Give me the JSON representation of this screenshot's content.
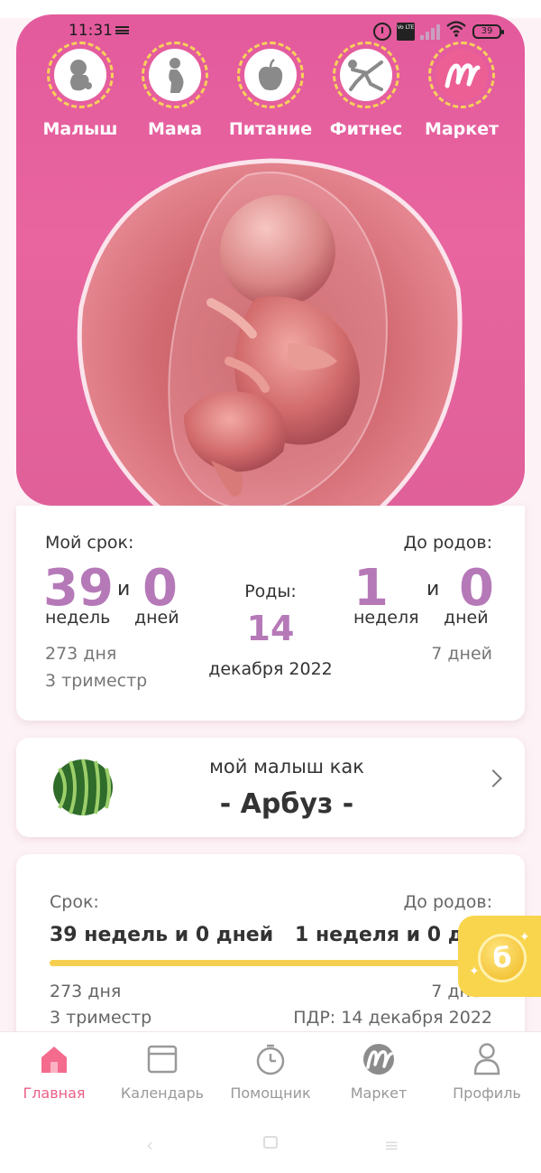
{
  "status_bar": {
    "time": "11:31",
    "volte": "Vo LTE",
    "battery": "39"
  },
  "top_nav": [
    {
      "label": "Малыш",
      "icon": "baby-icon"
    },
    {
      "label": "Мама",
      "icon": "pregnant-mother-icon"
    },
    {
      "label": "Питание",
      "icon": "apple-icon"
    },
    {
      "label": "Фитнес",
      "icon": "fitness-icon"
    },
    {
      "label": "Маркет",
      "icon": "market-logo-icon"
    }
  ],
  "term": {
    "my_term_label": "Мой срок:",
    "weeks_value": "39",
    "and_word": "и",
    "days_value": "0",
    "weeks_unit": "недель",
    "days_unit": "дней",
    "total_days": "273 дня",
    "trimester": "3 триместр",
    "birth_label": "Роды:",
    "birth_day": "14",
    "birth_month_year": "декабря 2022",
    "until_birth_label": "До родов:",
    "remaining_weeks": "1",
    "remaining_and": "и",
    "remaining_days": "0",
    "remaining_weeks_unit": "неделя",
    "remaining_days_unit": "дней",
    "remaining_total_days": "7 дней"
  },
  "baby_like": {
    "title": "мой малыш как",
    "fruit": "- Арбуз -"
  },
  "summary": {
    "term_label": "Срок:",
    "term_value": "39 недель и 0 дней",
    "until_label": "До родов:",
    "until_value": "1 неделя и 0 дней",
    "progress": 0.975,
    "total_days": "273 дня",
    "remaining_days": "7 дней",
    "trimester": "3 триместр",
    "due_date": "ПДР: 14 декабря 2022"
  },
  "bottom_nav": [
    {
      "label": "Главная",
      "icon": "home-icon",
      "active": true
    },
    {
      "label": "Календарь",
      "icon": "calendar-icon",
      "active": false
    },
    {
      "label": "Помощник",
      "icon": "stopwatch-icon",
      "active": false
    },
    {
      "label": "Маркет",
      "icon": "market-logo-icon",
      "active": false
    },
    {
      "label": "Профиль",
      "icon": "profile-icon",
      "active": false
    }
  ],
  "colors": {
    "header_pink": "#e35a9d",
    "accent_purple": "#b679b8",
    "accent_yellow": "#f6cf50",
    "active_nav": "#ec5f86"
  }
}
